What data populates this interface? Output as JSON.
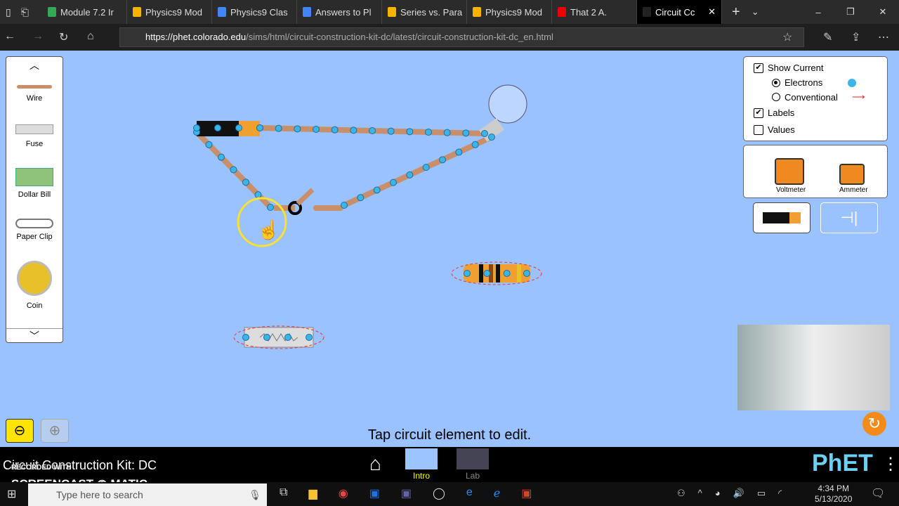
{
  "browser": {
    "tabs": [
      {
        "label": "Module 7.2 Ir",
        "color": "#34a853"
      },
      {
        "label": "Physics9 Mod",
        "color": "#f4b400"
      },
      {
        "label": "Physics9 Clas",
        "color": "#4285f4"
      },
      {
        "label": "Answers to Pl",
        "color": "#4285f4"
      },
      {
        "label": "Series vs. Para",
        "color": "#f4b400"
      },
      {
        "label": "Physics9 Mod",
        "color": "#f4b400"
      },
      {
        "label": "That 2 A.",
        "color": "#e00"
      },
      {
        "label": "Circuit Cc",
        "color": "#222"
      }
    ],
    "url_host": "https://phet.colorado.edu",
    "url_path": "/sims/html/circuit-construction-kit-dc/latest/circuit-construction-kit-dc_en.html"
  },
  "toolbox": {
    "items": [
      {
        "label": "Wire"
      },
      {
        "label": "Fuse"
      },
      {
        "label": "Dollar Bill"
      },
      {
        "label": "Paper Clip"
      },
      {
        "label": "Coin"
      }
    ]
  },
  "current_panel": {
    "show_current": "Show Current",
    "show_current_checked": true,
    "electrons": "Electrons",
    "electrons_selected": true,
    "conventional": "Conventional",
    "labels": "Labels",
    "labels_checked": true,
    "values": "Values",
    "values_checked": false
  },
  "meters": {
    "voltmeter": "Voltmeter",
    "ammeter": "Ammeter"
  },
  "status": "Tap circuit element to edit.",
  "sim": {
    "title": "Circuit Construction Kit: DC",
    "screens": [
      {
        "label": "Intro",
        "active": true
      },
      {
        "label": "Lab",
        "active": false
      }
    ],
    "logo": "PhET"
  },
  "watermark": {
    "line1": "RECORDED WITH",
    "line2": "SCREENCAST",
    "line3": "MATIC"
  },
  "taskbar": {
    "search_placeholder": "Type here to search",
    "time": "4:34 PM",
    "date": "5/13/2020"
  },
  "colors": {
    "background": "#99c2ff",
    "electron": "#3cb4e6",
    "wire": "#c98f6b"
  }
}
